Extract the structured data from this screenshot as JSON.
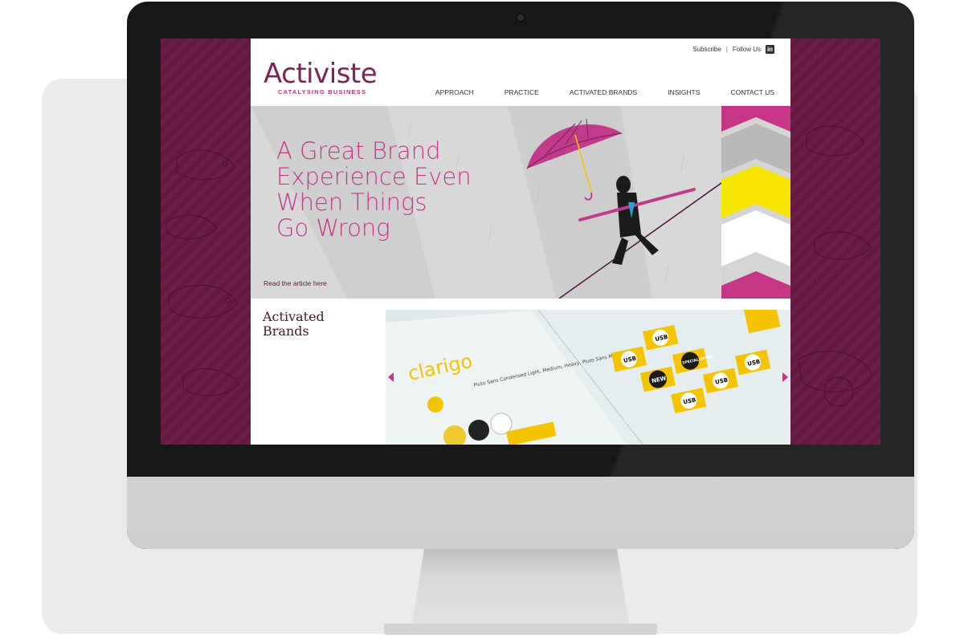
{
  "site": {
    "logo": {
      "name": "Activiste",
      "tagline": "CATALYSING BUSINESS"
    },
    "topbar": {
      "subscribe": "Subscribe",
      "separator": "|",
      "follow": "Follow Us",
      "linkedin_icon": "in"
    },
    "nav": {
      "items": [
        "APPROACH",
        "PRACTICE",
        "ACTIVATED BRANDS",
        "INSIGHTS",
        "CONTACT US"
      ]
    },
    "hero": {
      "title_lines": [
        "A Great Brand",
        "Experience Even",
        "When Things",
        "Go Wrong"
      ],
      "link": "Read the article here"
    },
    "brands": {
      "heading_lines": [
        "Activated",
        "Brands"
      ]
    },
    "carousel": {
      "brand_name": "clarigo",
      "font_note": "Pluto Sans Condensed Light, Medium, Heavy, Pluto Sans Medium",
      "badges": [
        "USB",
        "USB",
        "NEW",
        "SPECIAL OFFER",
        "USB",
        "USB",
        "USB"
      ]
    }
  },
  "colors": {
    "brand": "#7a2558",
    "accent": "#c8358a",
    "plum_bg": "#6b1f4a",
    "yellow": "#f5c400",
    "hero_grey": "#d8d8d8"
  },
  "icons": {
    "linkedin": "linkedin-icon",
    "prev": "chevron-left-icon",
    "next": "chevron-right-icon",
    "camera": "camera-icon"
  }
}
